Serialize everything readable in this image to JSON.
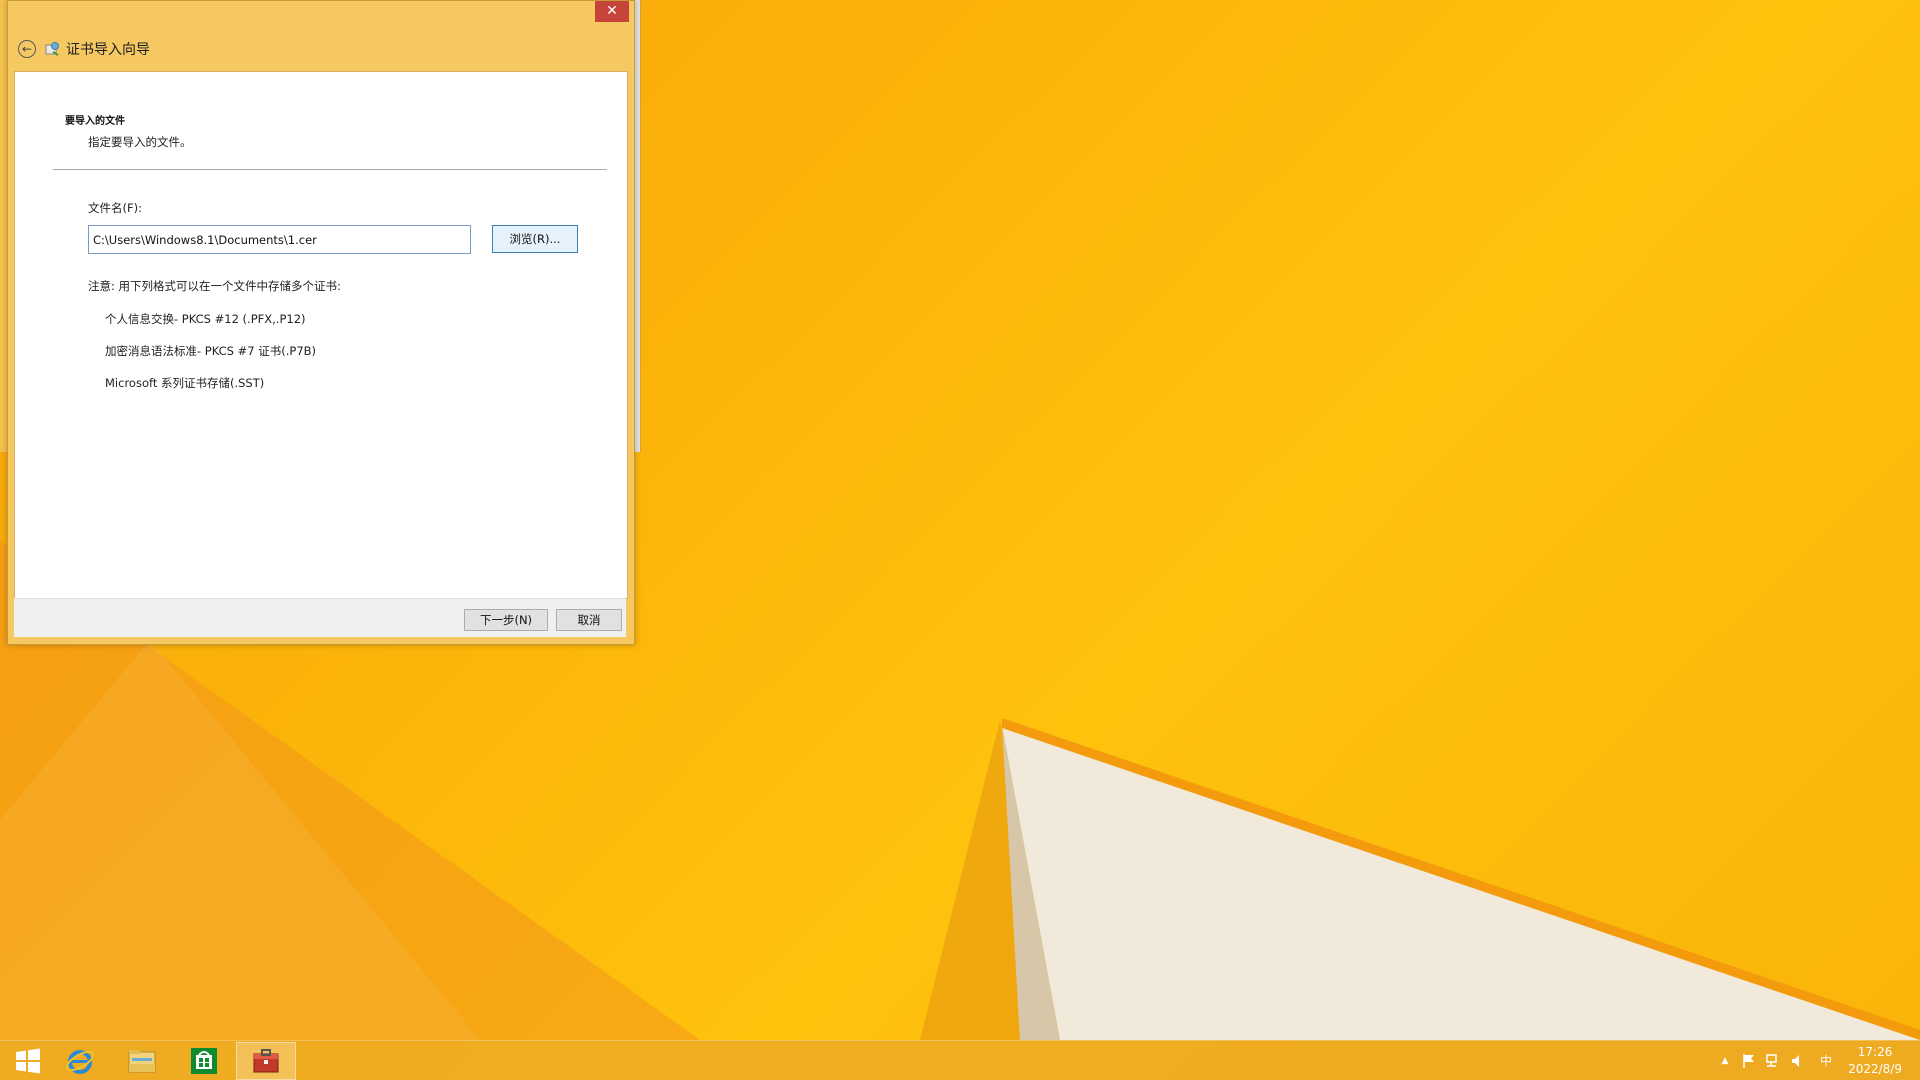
{
  "dialog": {
    "title": "证书导入向导",
    "close_label": "✕",
    "section_title": "要导入的文件",
    "section_subtitle": "指定要导入的文件。",
    "filename_label": "文件名(F):",
    "filename_value": "C:\\Users\\Windows8.1\\Documents\\1.cer",
    "browse_label": "浏览(R)...",
    "note": "注意: 用下列格式可以在一个文件中存储多个证书:",
    "formats": [
      "个人信息交换- PKCS #12 (.PFX,.P12)",
      "加密消息语法标准- PKCS #7 证书(.P7B)",
      "Microsoft 系列证书存储(.SST)"
    ],
    "next_label": "下一步(N)",
    "cancel_label": "取消"
  },
  "taskbar": {
    "items": [
      {
        "icon": "windows-start-icon"
      },
      {
        "icon": "internet-explorer-icon"
      },
      {
        "icon": "file-explorer-icon"
      },
      {
        "icon": "store-icon"
      },
      {
        "icon": "certificate-manager-icon",
        "active": true
      }
    ],
    "tray": {
      "chevron": "▲",
      "ime": "中",
      "time": "17:26",
      "date": "2022/8/9"
    }
  },
  "colors": {
    "wallpaper": "#fbb40a",
    "accent": "#f5c862",
    "close": "#c7443b"
  }
}
